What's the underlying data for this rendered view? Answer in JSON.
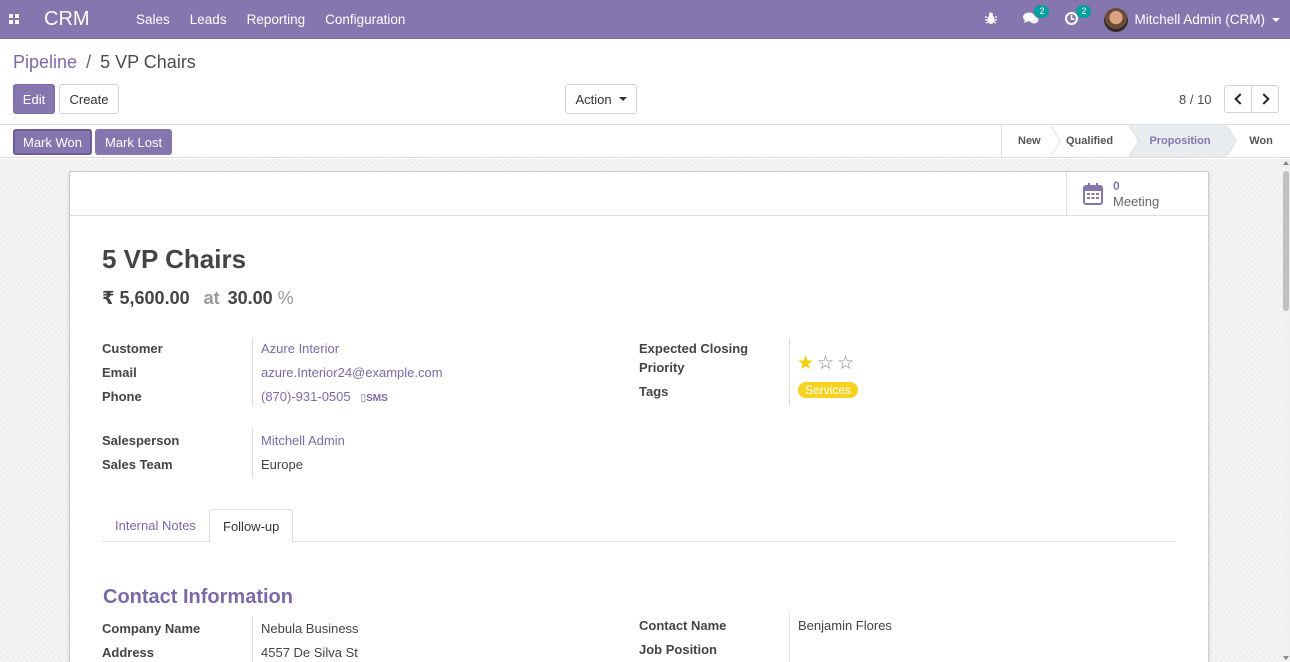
{
  "navbar": {
    "app_name": "CRM",
    "menus": [
      "Sales",
      "Leads",
      "Reporting",
      "Configuration"
    ],
    "messages_badge": "2",
    "activities_badge": "2",
    "user_name": "Mitchell Admin (CRM)"
  },
  "breadcrumb": {
    "parent": "Pipeline",
    "separator": "/",
    "current": "5 VP Chairs"
  },
  "toolbar": {
    "edit_label": "Edit",
    "create_label": "Create",
    "action_label": "Action",
    "pager": "8 / 10"
  },
  "statusbar": {
    "mark_won": "Mark Won",
    "mark_lost": "Mark Lost",
    "stages": [
      "New",
      "Qualified",
      "Proposition",
      "Won"
    ],
    "active_stage": "Proposition"
  },
  "smart_button": {
    "value": "0",
    "label": "Meeting"
  },
  "lead": {
    "title": "5 VP Chairs",
    "revenue": "₹ 5,600.00",
    "at": "at",
    "probability": "30.00",
    "percent": "%"
  },
  "fields_left": {
    "customer_label": "Customer",
    "customer_value": "Azure Interior",
    "email_label": "Email",
    "email_value": "azure.Interior24@example.com",
    "phone_label": "Phone",
    "phone_value": "(870)-931-0505",
    "sms_label": "SMS",
    "salesperson_label": "Salesperson",
    "salesperson_value": "Mitchell Admin",
    "team_label": "Sales Team",
    "team_value": "Europe"
  },
  "fields_right": {
    "closing_label": "Expected Closing",
    "priority_label": "Priority",
    "priority_stars": 1,
    "priority_max": 3,
    "tags_label": "Tags",
    "tag_value": "Services",
    "tag_color": "#f5d320"
  },
  "tabs": [
    "Internal Notes",
    "Follow-up"
  ],
  "active_tab": "Follow-up",
  "contact_section": {
    "title": "Contact Information",
    "company_label": "Company Name",
    "company_value": "Nebula Business",
    "address_label": "Address",
    "address_value": "4557 De Silva St",
    "contact_name_label": "Contact Name",
    "contact_name_value": "Benjamin Flores",
    "job_label": "Job Position"
  },
  "colors": {
    "brand": "#8676b0",
    "link": "#7c6aa6",
    "badge": "#00a09d",
    "star": "#f3cc00"
  }
}
